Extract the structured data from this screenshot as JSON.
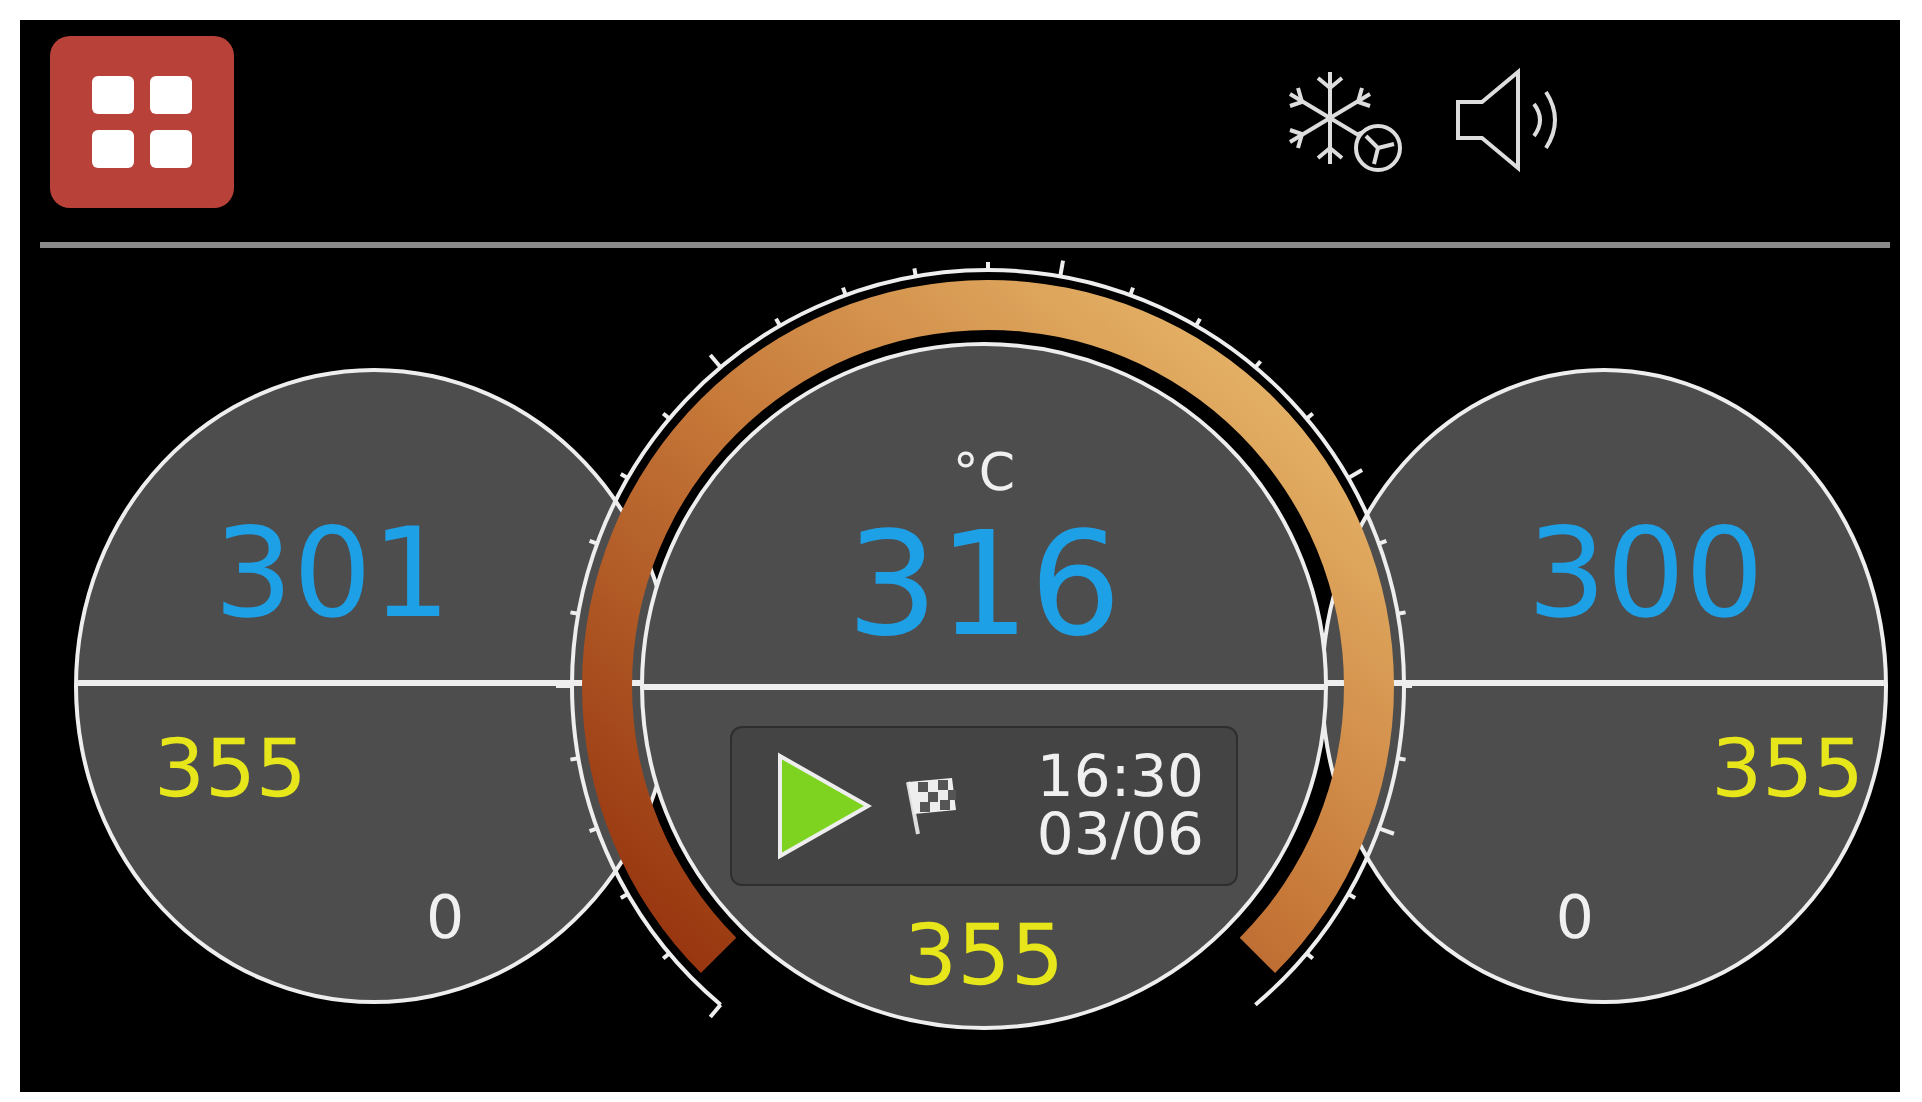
{
  "dials": [
    {
      "kind": "side",
      "value": "301",
      "setpoint": "355",
      "reading": "0"
    },
    {
      "kind": "main",
      "unit": "°C",
      "value": "316",
      "time": "16:30",
      "date": "03/06",
      "setpoint": "355"
    },
    {
      "kind": "side",
      "value": "300",
      "setpoint": "355",
      "reading": "0"
    }
  ]
}
